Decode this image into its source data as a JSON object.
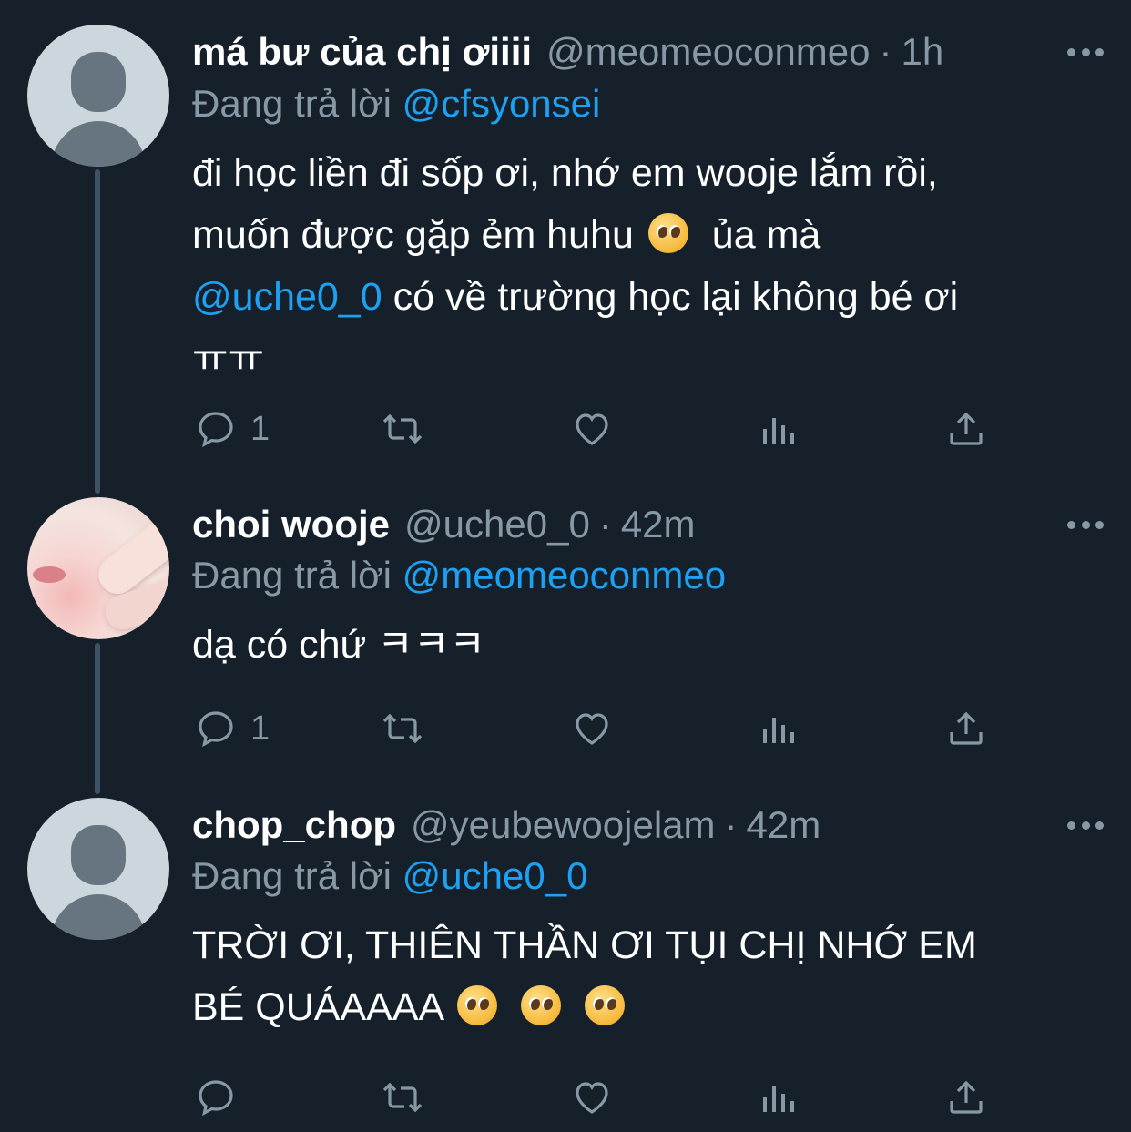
{
  "colors": {
    "background": "#15202b",
    "secondary_text": "#8899a6",
    "accent": "#1da1f2",
    "thread_line": "#3d5466"
  },
  "tweets": [
    {
      "display_name": "má bư của chị ơiiii",
      "handle": "@meomeoconmeo",
      "separator": "·",
      "time": "1h",
      "replying_prefix": "Đang trả lời",
      "replying_to": "@cfsyonsei",
      "text_1": "đi học liền đi sốp ơi, nhớ em wooje lắm rồi,",
      "text_2": "muốn được gặp ẻm huhu",
      "text_2b": "ủa mà",
      "text_3_mention": "@uche0_0",
      "text_3": "có về trường học lại không bé ơi",
      "text_4": "ㅠㅠ",
      "emoji": "pleading-face",
      "reply_count": "1"
    },
    {
      "display_name": "choi wooje",
      "handle": "@uche0_0",
      "separator": "·",
      "time": "42m",
      "replying_prefix": "Đang trả lời",
      "replying_to": "@meomeoconmeo",
      "text_1": "dạ có chứ ㅋㅋㅋ",
      "reply_count": "1"
    },
    {
      "display_name": "chop_chop",
      "handle": "@yeubewoojelam",
      "separator": "·",
      "time": "42m",
      "replying_prefix": "Đang trả lời",
      "replying_to": "@uche0_0",
      "text_1": "TRỜI ƠI, THIÊN THẦN ƠI TỤI CHỊ NHỚ EM",
      "text_2": "BÉ QUÁAAAA",
      "emoji": "pleading-face",
      "reply_count": ""
    }
  ],
  "icons": [
    "reply-icon",
    "retweet-icon",
    "like-icon",
    "analytics-icon",
    "share-icon",
    "more-icon"
  ]
}
